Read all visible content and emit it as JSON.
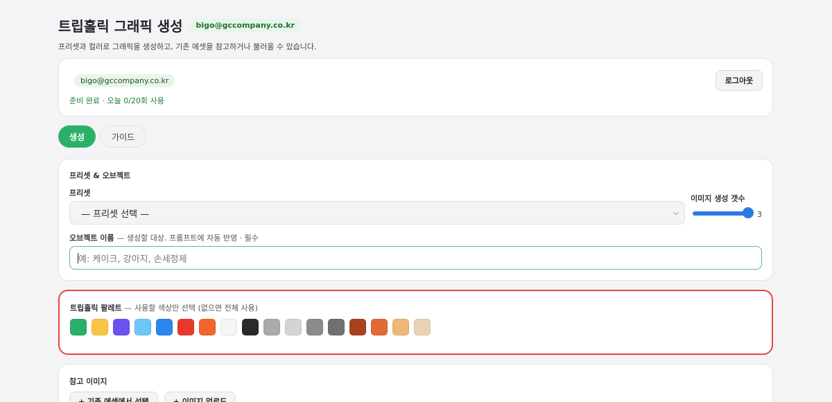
{
  "header": {
    "title": "트립홀릭 그래픽 생성",
    "email_badge": "bigo@gccompany.co.kr",
    "subtitle": "프리셋과 컬러로 그래픽을 생성하고, 기존 에셋을 참고하거나 불러올 수 있습니다."
  },
  "account": {
    "email": "bigo@gccompany.co.kr",
    "status": "준비 완료 · 오늘 0/20회 사용",
    "logout_label": "로그아웃"
  },
  "tabs": [
    {
      "label": "생성",
      "active": true
    },
    {
      "label": "가이드",
      "active": false
    }
  ],
  "preset_section": {
    "title": "프리셋 & 오브젝트",
    "preset_label": "프리셋",
    "preset_value": "— 프리셋 선택 —",
    "count_label": "이미지 생성 갯수",
    "count_value": "3",
    "object_label": "오브젝트 이름",
    "object_hint": "— 생성할 대상. 프롬프트에 자동 반영 · 필수",
    "object_placeholder": "예: 케이크, 강아지, 손세정제"
  },
  "palette_section": {
    "title": "트립홀릭 팔레트",
    "hint": "— 사용할 색상만 선택 (없으면 전체 사용)",
    "colors": [
      "#2bb06a",
      "#f8c444",
      "#6a52f0",
      "#6ec6f8",
      "#2b86f0",
      "#e8382e",
      "#f4642e",
      "#f5f5f5",
      "#2a2a2a",
      "#a9aaac",
      "#d3d4d6",
      "#8a8b8d",
      "#6e7072",
      "#a6421e",
      "#df6a34",
      "#efb878",
      "#ead3b4"
    ]
  },
  "reference_section": {
    "title": "참고 이미지",
    "select_asset_label": "+ 기존 에셋에서 선택",
    "upload_label": "+ 이미지 업로드"
  }
}
